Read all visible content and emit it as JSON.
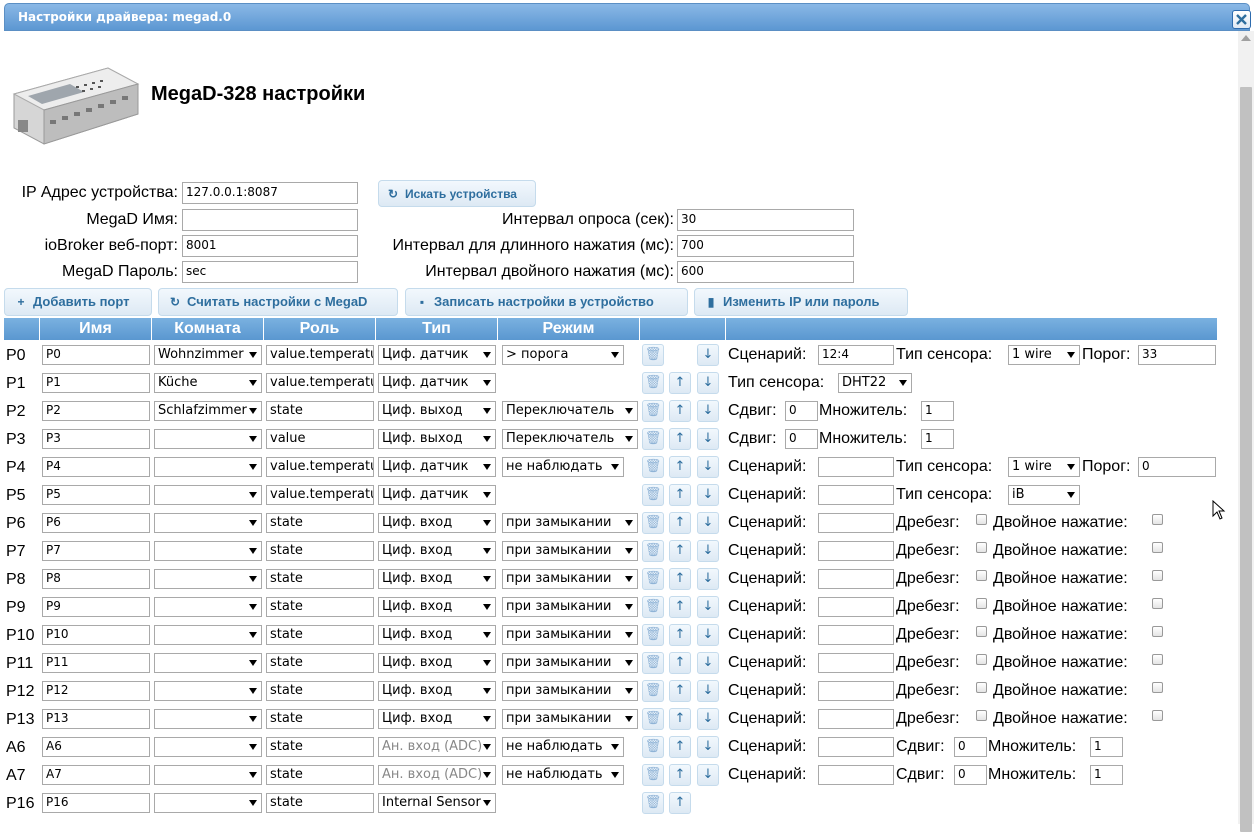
{
  "window": {
    "title": "Настройки драйвера: megad.0"
  },
  "header": {
    "title": "MegaD-328 настройки"
  },
  "settings": {
    "ip_label": "IP Адрес устройства:",
    "ip_value": "127.0.0.1:8087",
    "search_button": "Искать устройства",
    "name_label": "MegaD Имя:",
    "name_value": "",
    "webport_label": "ioBroker веб-порт:",
    "webport_value": "8001",
    "password_label": "MegaD Пароль:",
    "password_value": "sec",
    "poll_label": "Интервал опроса (сек):",
    "poll_value": "30",
    "long_label": "Интервал для длинного нажатия (мс):",
    "long_value": "700",
    "double_label": "Интервал двойного нажатия (мс):",
    "double_value": "600"
  },
  "toolbar": {
    "add_port": "Добавить порт",
    "read_settings": "Считать настройки с MegaD",
    "write_settings": "Записать настройки в устройство",
    "change_ip": "Изменить IP или пароль"
  },
  "table": {
    "headers": {
      "name": "Имя",
      "room": "Комната",
      "role": "Роль",
      "type": "Тип",
      "mode": "Режим"
    },
    "labels": {
      "scenario": "Сценарий:",
      "sensor_type": "Тип сенсора:",
      "threshold": "Порог:",
      "offset": "Сдвиг:",
      "factor": "Множитель:",
      "debounce": "Дребезг:",
      "double_click": "Двойное нажатие:"
    },
    "rows": [
      {
        "port": "P0",
        "name": "P0",
        "room": "Wohnzimmer",
        "role": "value.temperature",
        "type": "Циф. датчик",
        "mode": "> порога",
        "scenario": "12:4",
        "sensor": "1 wire",
        "threshold": "33"
      },
      {
        "port": "P1",
        "name": "P1",
        "room": "Küche",
        "role": "value.temperature",
        "type": "Циф. датчик",
        "sensor": "DHT22"
      },
      {
        "port": "P2",
        "name": "P2",
        "room": "Schlafzimmer",
        "role": "state",
        "type": "Циф. выход",
        "mode": "Переключатель",
        "offset": "0",
        "factor": "1"
      },
      {
        "port": "P3",
        "name": "P3",
        "room": "",
        "role": "value",
        "type": "Циф. выход",
        "mode": "Переключатель",
        "offset": "0",
        "factor": "1"
      },
      {
        "port": "P4",
        "name": "P4",
        "room": "",
        "role": "value.temperature",
        "type": "Циф. датчик",
        "mode": "не наблюдать",
        "scenario": "",
        "sensor": "1 wire",
        "threshold": "0"
      },
      {
        "port": "P5",
        "name": "P5",
        "room": "",
        "role": "value.temperature",
        "type": "Циф. датчик",
        "scenario": "",
        "sensor": "iB"
      },
      {
        "port": "P6",
        "name": "P6",
        "room": "",
        "role": "state",
        "type": "Циф. вход",
        "mode": "при замыкании",
        "scenario": ""
      },
      {
        "port": "P7",
        "name": "P7",
        "room": "",
        "role": "state",
        "type": "Циф. вход",
        "mode": "при замыкании",
        "scenario": ""
      },
      {
        "port": "P8",
        "name": "P8",
        "room": "",
        "role": "state",
        "type": "Циф. вход",
        "mode": "при замыкании",
        "scenario": ""
      },
      {
        "port": "P9",
        "name": "P9",
        "room": "",
        "role": "state",
        "type": "Циф. вход",
        "mode": "при замыкании",
        "scenario": ""
      },
      {
        "port": "P10",
        "name": "P10",
        "room": "",
        "role": "state",
        "type": "Циф. вход",
        "mode": "при замыкании",
        "scenario": ""
      },
      {
        "port": "P11",
        "name": "P11",
        "room": "",
        "role": "state",
        "type": "Циф. вход",
        "mode": "при замыкании",
        "scenario": ""
      },
      {
        "port": "P12",
        "name": "P12",
        "room": "",
        "role": "state",
        "type": "Циф. вход",
        "mode": "при замыкании",
        "scenario": ""
      },
      {
        "port": "P13",
        "name": "P13",
        "room": "",
        "role": "state",
        "type": "Циф. вход",
        "mode": "при замыкании",
        "scenario": ""
      },
      {
        "port": "A6",
        "name": "A6",
        "room": "",
        "role": "state",
        "type": "Ан. вход (ADC)",
        "mode": "не наблюдать",
        "scenario": "",
        "offset": "0",
        "factor": "1"
      },
      {
        "port": "A7",
        "name": "A7",
        "room": "",
        "role": "state",
        "type": "Ан. вход (ADC)",
        "mode": "не наблюдать",
        "scenario": "",
        "offset": "0",
        "factor": "1"
      },
      {
        "port": "P16",
        "name": "P16",
        "room": "",
        "role": "state",
        "type": "Internal Sensor"
      }
    ]
  }
}
